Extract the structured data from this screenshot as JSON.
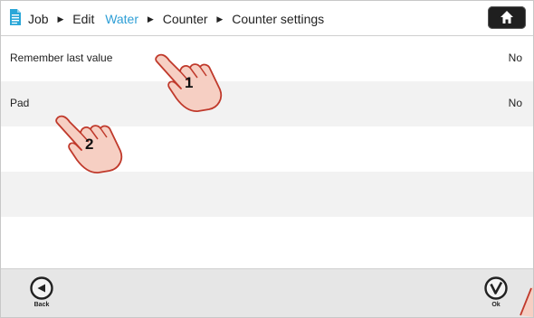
{
  "breadcrumb": {
    "items": [
      {
        "label": "Job",
        "active": false
      },
      {
        "label": "Edit",
        "active": false
      },
      {
        "label": "Water",
        "active": true
      },
      {
        "label": "Counter",
        "active": false
      },
      {
        "label": "Counter settings",
        "active": false
      }
    ]
  },
  "settings": [
    {
      "label": "Remember last value",
      "value": "No"
    },
    {
      "label": "Pad",
      "value": "No"
    }
  ],
  "footer": {
    "back_label": "Back",
    "ok_label": "Ok"
  },
  "annotations": {
    "hand_1_number": "1",
    "hand_2_number": "2"
  },
  "colors": {
    "accent": "#2f9fd6",
    "hand_fill": "#f6cfc3",
    "hand_stroke": "#c0392b"
  },
  "icons": {
    "header_left": "document-icon",
    "header_right": "home-icon",
    "back": "left-arrow-circle-icon",
    "ok": "checkmark-circle-icon",
    "annotation": "pointing-hand-icon"
  }
}
